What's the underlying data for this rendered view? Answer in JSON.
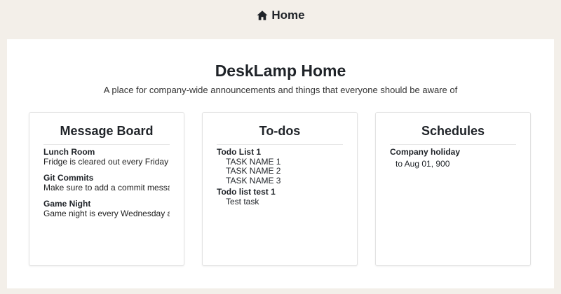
{
  "header": {
    "title": "Home",
    "icon": "home-icon"
  },
  "main": {
    "title": "DeskLamp Home",
    "subtitle": "A place for company-wide announcements and things that everyone should be aware of"
  },
  "message_board": {
    "title": "Message Board",
    "items": [
      {
        "title": "Lunch Room",
        "text": "Fridge is cleared out every Friday"
      },
      {
        "title": "Git Commits",
        "text": "Make sure to add a commit messa"
      },
      {
        "title": "Game Night",
        "text": "Game night is every Wednesday aft"
      }
    ]
  },
  "todos": {
    "title": "To-dos",
    "lists": [
      {
        "name": "Todo List 1",
        "items": [
          "TASK NAME 1",
          "TASK NAME 2",
          "TASK NAME 3"
        ]
      },
      {
        "name": "Todo list test 1",
        "items": [
          "Test task"
        ]
      }
    ]
  },
  "schedules": {
    "title": "Schedules",
    "items": [
      {
        "name": "Company holiday",
        "date": "to Aug 01, 900"
      }
    ]
  }
}
